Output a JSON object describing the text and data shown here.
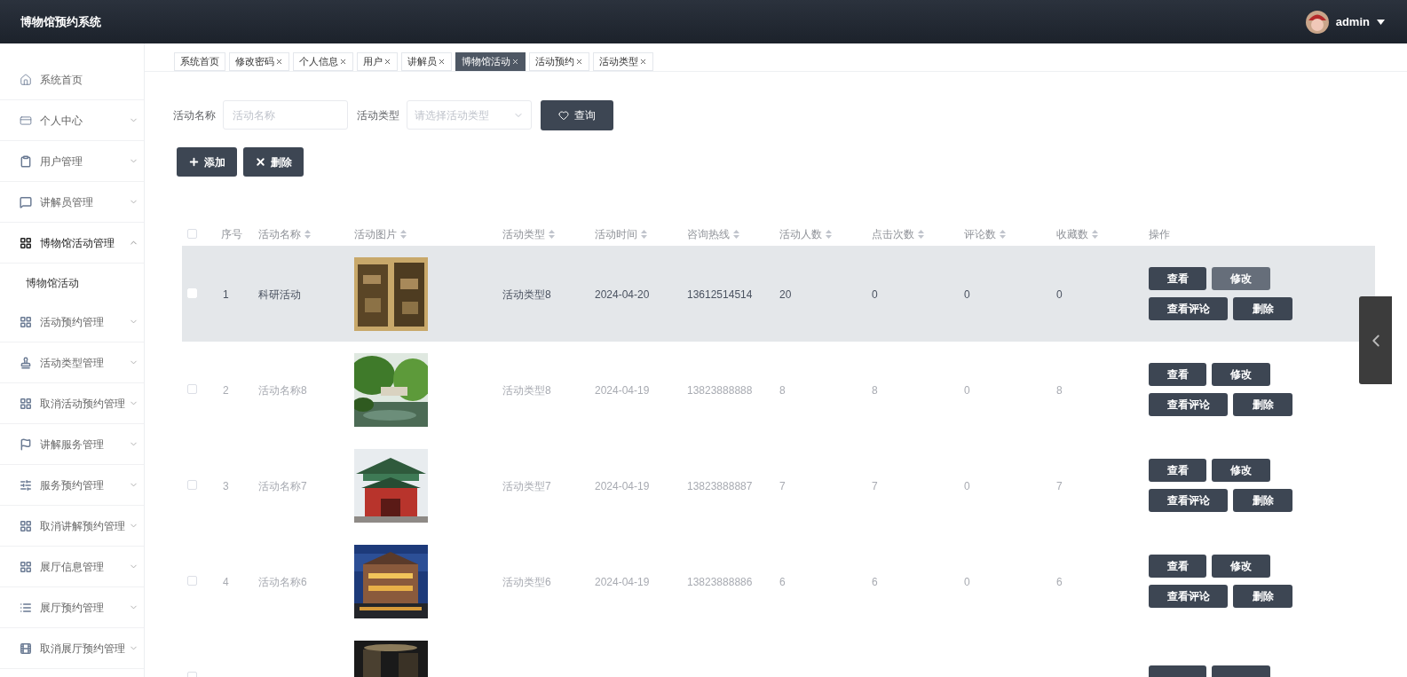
{
  "header": {
    "title": "博物馆预约系统",
    "user": {
      "name": "admin"
    }
  },
  "sidebar": {
    "items": [
      {
        "label": "系统首页"
      },
      {
        "label": "个人中心",
        "expanded": false
      },
      {
        "label": "用户管理",
        "expanded": false
      },
      {
        "label": "讲解员管理",
        "expanded": false
      },
      {
        "label": "博物馆活动管理",
        "expanded": true,
        "children": [
          {
            "label": "博物馆活动"
          }
        ]
      },
      {
        "label": "活动预约管理",
        "expanded": false
      },
      {
        "label": "活动类型管理",
        "expanded": false
      },
      {
        "label": "取消活动预约管理",
        "expanded": false
      },
      {
        "label": "讲解服务管理",
        "expanded": false
      },
      {
        "label": "服务预约管理",
        "expanded": false
      },
      {
        "label": "取消讲解预约管理",
        "expanded": false
      },
      {
        "label": "展厅信息管理",
        "expanded": false
      },
      {
        "label": "展厅预约管理",
        "expanded": false
      },
      {
        "label": "取消展厅预约管理",
        "expanded": false
      }
    ]
  },
  "tabs": [
    {
      "label": "系统首页",
      "selected": false,
      "closable": false
    },
    {
      "label": "修改密码",
      "selected": false,
      "closable": true
    },
    {
      "label": "个人信息",
      "selected": false,
      "closable": true
    },
    {
      "label": "用户",
      "selected": false,
      "closable": true
    },
    {
      "label": "讲解员",
      "selected": false,
      "closable": true
    },
    {
      "label": "博物馆活动",
      "selected": true,
      "closable": true
    },
    {
      "label": "活动预约",
      "selected": false,
      "closable": true
    },
    {
      "label": "活动类型",
      "selected": false,
      "closable": true
    }
  ],
  "search": {
    "fields": [
      {
        "kind": "input",
        "label": "活动名称",
        "placeholder": "活动名称"
      },
      {
        "kind": "select",
        "label": "活动类型",
        "placeholder": "请选择活动类型"
      }
    ],
    "button": "查询"
  },
  "actions": [
    {
      "kind": "add",
      "label": "添加"
    },
    {
      "kind": "delete",
      "label": "删除"
    }
  ],
  "table": {
    "select_all": {
      "checked": false
    },
    "columns": [
      {
        "label": "序号",
        "sortable": false
      },
      {
        "label": "活动名称",
        "sortable": true
      },
      {
        "label": "活动图片",
        "sortable": true
      },
      {
        "label": "活动类型",
        "sortable": true
      },
      {
        "label": "活动时间",
        "sortable": true
      },
      {
        "label": "咨询热线",
        "sortable": true
      },
      {
        "label": "活动人数",
        "sortable": true
      },
      {
        "label": "点击次数",
        "sortable": true
      },
      {
        "label": "评论数",
        "sortable": true
      },
      {
        "label": "收藏数",
        "sortable": true
      },
      {
        "label": "操作",
        "sortable": false
      }
    ],
    "rows": [
      {
        "checked": false,
        "highlighted": true,
        "cells": [
          "1",
          "科研活动",
          "",
          "活动类型8",
          "2024-04-20",
          "13612514514",
          "20",
          "0",
          "0",
          "0"
        ],
        "buttons": [
          {
            "label": "查看",
            "hovered": false
          },
          {
            "label": "修改",
            "hovered": true
          },
          {
            "label": "查看评论",
            "hovered": false
          },
          {
            "label": "删除",
            "hovered": false
          }
        ]
      },
      {
        "checked": false,
        "highlighted": false,
        "cells": [
          "2",
          "活动名称8",
          "",
          "活动类型8",
          "2024-04-19",
          "13823888888",
          "8",
          "8",
          "0",
          "8"
        ],
        "buttons": [
          {
            "label": "查看",
            "hovered": false
          },
          {
            "label": "修改",
            "hovered": false
          },
          {
            "label": "查看评论",
            "hovered": false
          },
          {
            "label": "删除",
            "hovered": false
          }
        ]
      },
      {
        "checked": false,
        "highlighted": false,
        "cells": [
          "3",
          "活动名称7",
          "",
          "活动类型7",
          "2024-04-19",
          "13823888887",
          "7",
          "7",
          "0",
          "7"
        ],
        "buttons": [
          {
            "label": "查看",
            "hovered": false
          },
          {
            "label": "修改",
            "hovered": false
          },
          {
            "label": "查看评论",
            "hovered": false
          },
          {
            "label": "删除",
            "hovered": false
          }
        ]
      },
      {
        "checked": false,
        "highlighted": false,
        "cells": [
          "4",
          "活动名称6",
          "",
          "活动类型6",
          "2024-04-19",
          "13823888886",
          "6",
          "6",
          "0",
          "6"
        ],
        "buttons": [
          {
            "label": "查看",
            "hovered": false
          },
          {
            "label": "修改",
            "hovered": false
          },
          {
            "label": "查看评论",
            "hovered": false
          },
          {
            "label": "删除",
            "hovered": false
          }
        ]
      },
      {
        "checked": false,
        "highlighted": false,
        "cells": [],
        "buttons": [
          {
            "hovered": false
          },
          {
            "hovered": false
          }
        ]
      }
    ]
  }
}
